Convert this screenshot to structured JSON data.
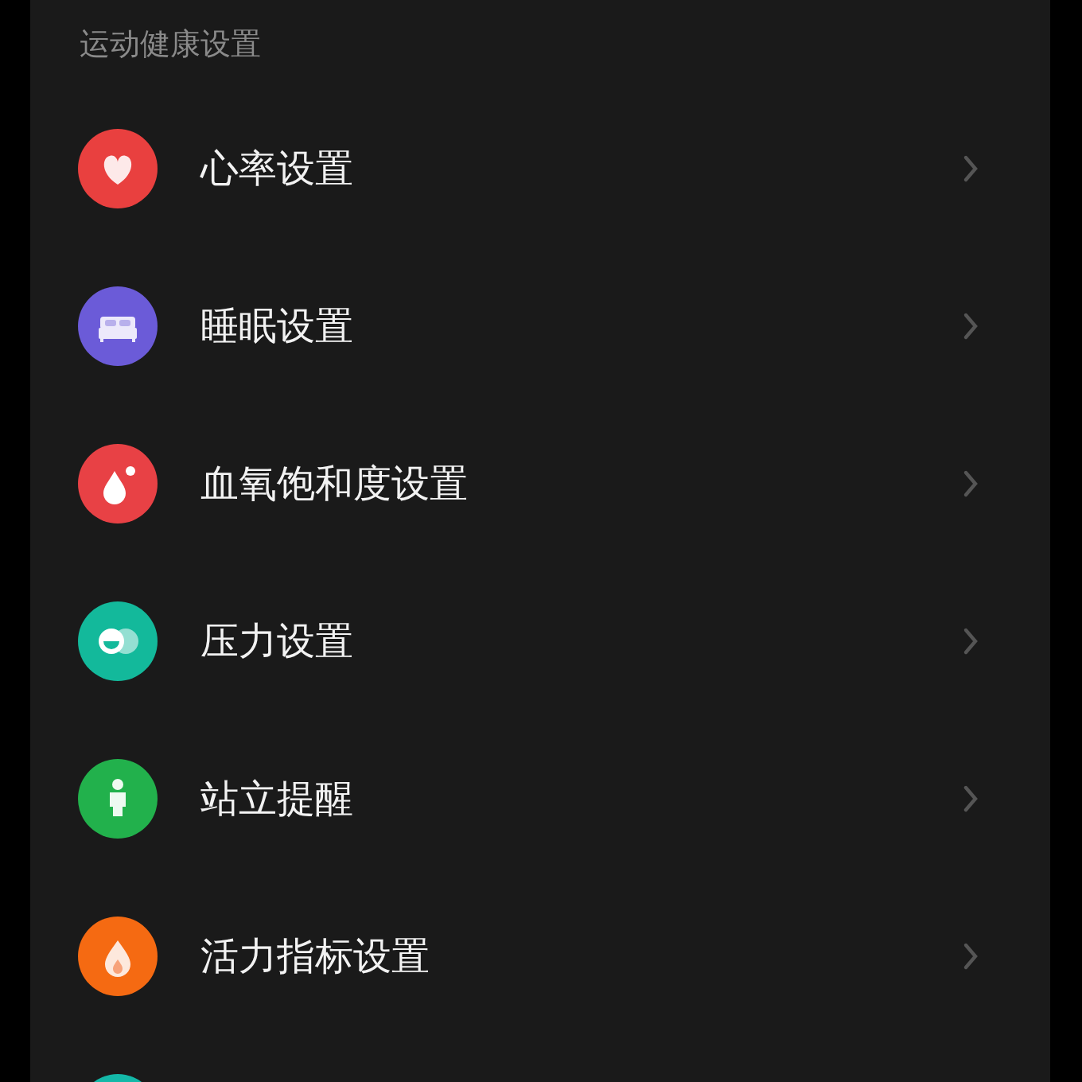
{
  "section_title": "运动健康设置",
  "items": [
    {
      "kind": "heart",
      "color": "#e9403f",
      "label": "心率设置"
    },
    {
      "kind": "bed",
      "color": "#6b5bd8",
      "label": "睡眠设置"
    },
    {
      "kind": "drop",
      "color": "#e84145",
      "label": "血氧饱和度设置"
    },
    {
      "kind": "faces",
      "color": "#13b99b",
      "label": "压力设置"
    },
    {
      "kind": "person",
      "color": "#22b14c",
      "label": "站立提醒"
    },
    {
      "kind": "flame",
      "color": "#f56a12",
      "label": "活力指标设置"
    },
    {
      "kind": "partial",
      "color": "#14b8a8"
    }
  ]
}
